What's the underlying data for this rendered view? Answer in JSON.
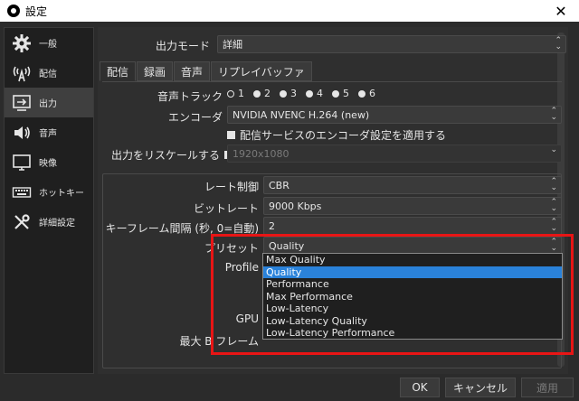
{
  "window": {
    "title": "設定",
    "close_glyph": "✕"
  },
  "sidebar": {
    "items": [
      {
        "label": "一般",
        "icon": "gear-icon"
      },
      {
        "label": "配信",
        "icon": "broadcast-icon"
      },
      {
        "label": "出力",
        "icon": "output-icon"
      },
      {
        "label": "音声",
        "icon": "speaker-icon"
      },
      {
        "label": "映像",
        "icon": "monitor-icon"
      },
      {
        "label": "ホットキー",
        "icon": "keyboard-icon"
      },
      {
        "label": "詳細設定",
        "icon": "tools-icon"
      }
    ],
    "selected_index": 2
  },
  "output_mode": {
    "label": "出力モード",
    "value": "詳細"
  },
  "tabs": [
    "配信",
    "録画",
    "音声",
    "リプレイバッファ"
  ],
  "audio_track": {
    "label": "音声トラック",
    "options": [
      "1",
      "2",
      "3",
      "4",
      "5",
      "6"
    ],
    "selected": "1"
  },
  "encoder": {
    "label": "エンコーダ",
    "value": "NVIDIA NVENC H.264 (new)"
  },
  "enforce_service": {
    "label": "配信サービスのエンコーダ設定を適用する",
    "checked": true
  },
  "rescale": {
    "label": "出力をリスケールする",
    "value": "1920x1080"
  },
  "rate_control": {
    "label": "レート制御",
    "value": "CBR"
  },
  "bitrate": {
    "label": "ビットレート",
    "value": "9000 Kbps"
  },
  "keyframe": {
    "label": "キーフレーム間隔 (秒, 0=自動)",
    "value": "2"
  },
  "preset": {
    "label": "プリセット",
    "value": "Quality",
    "options": [
      "Max Quality",
      "Quality",
      "Performance",
      "Max Performance",
      "Low-Latency",
      "Low-Latency Quality",
      "Low-Latency Performance"
    ],
    "selected_index": 1
  },
  "hidden_labels": {
    "profile": "Profile",
    "gpu": "GPU",
    "bframes": "最大 B フレーム"
  },
  "buttons": {
    "ok": "OK",
    "cancel": "キャンセル",
    "apply": "適用"
  },
  "colors": {
    "highlight": "#e81515",
    "selection": "#2a82da"
  }
}
